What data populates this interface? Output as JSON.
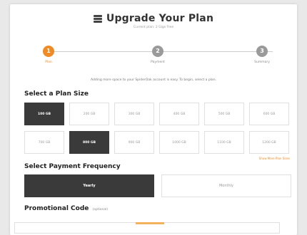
{
  "header": {
    "title": "Upgrade Your Plan",
    "subtitle": "Current plan: 2 Gigs Free"
  },
  "stepper": {
    "steps": [
      {
        "number": "1",
        "label": "Plan"
      },
      {
        "number": "2",
        "label": "Payment"
      },
      {
        "number": "3",
        "label": "Summary"
      }
    ]
  },
  "intro_text": "Adding more space to your SpiderOak account is easy. To begin, select a plan.",
  "plan_size": {
    "heading": "Select a Plan Size",
    "options": [
      "100 GB",
      "200 GB",
      "300 GB",
      "400 GB",
      "500 GB",
      "600 GB",
      "700 GB",
      "800 GB",
      "900 GB",
      "1000 GB",
      "1100 GB",
      "1200 GB"
    ],
    "selected": "100 GB",
    "hover": "800 GB",
    "more_link": "Show More Plan Sizes"
  },
  "frequency": {
    "heading": "Select Payment Frequency",
    "options": [
      "Yearly",
      "Monthly"
    ],
    "selected": "Yearly"
  },
  "promo": {
    "heading": "Promotional Code",
    "optional_label": "(optional)"
  },
  "colors": {
    "accent": "#f08a24",
    "selected_bg": "#3a3a3a",
    "inactive_step": "#9a9a9a"
  }
}
